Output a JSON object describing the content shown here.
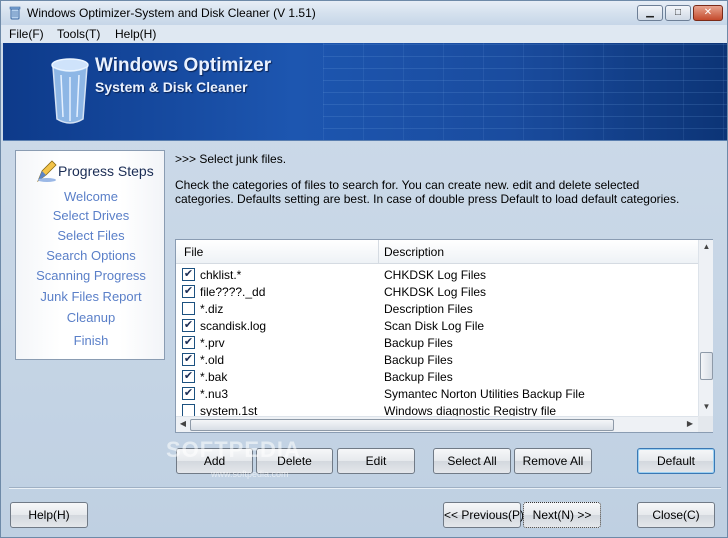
{
  "window": {
    "title": "Windows Optimizer-System and Disk Cleaner (V 1.51)",
    "minimize_glyph": "▁",
    "maximize_glyph": "□",
    "close_glyph": "✕"
  },
  "menu": {
    "items": [
      {
        "label": "File(F)"
      },
      {
        "label": "Tools(T)"
      },
      {
        "label": "Help(H)"
      }
    ]
  },
  "banner": {
    "title": "Windows Optimizer",
    "subtitle": "System & Disk Cleaner",
    "icon": "recycle-bin-icon"
  },
  "steps": {
    "title": "Progress Steps",
    "icon": "pen-icon",
    "items": [
      {
        "label": "Welcome"
      },
      {
        "label": "Select Drives"
      },
      {
        "label": "Select Files"
      },
      {
        "label": "Search Options"
      },
      {
        "label": "Scanning Progress"
      },
      {
        "label": "Junk Files Report"
      },
      {
        "label": "Cleanup"
      },
      {
        "label": "Finish"
      }
    ]
  },
  "main": {
    "instruction": ">>> Select junk files.",
    "description": "Check the categories of files to search for. You can create new. edit and delete selected categories. Defaults setting are best. In case of double press Default to load default categories."
  },
  "file_list": {
    "columns": [
      "File",
      "Description"
    ],
    "check_glyph": "✔",
    "rows": [
      {
        "file": "chklist.*",
        "description": "CHKDSK Log Files",
        "checked": true
      },
      {
        "file": "file????._dd",
        "description": "CHKDSK Log Files",
        "checked": true
      },
      {
        "file": "*.diz",
        "description": "Description Files",
        "checked": false
      },
      {
        "file": "scandisk.log",
        "description": "Scan Disk Log File",
        "checked": true
      },
      {
        "file": "*.prv",
        "description": "Backup Files",
        "checked": true
      },
      {
        "file": "*.old",
        "description": "Backup Files",
        "checked": true
      },
      {
        "file": "*.bak",
        "description": "Backup Files",
        "checked": true
      },
      {
        "file": "*.nu3",
        "description": "Symantec Norton Utilities Backup File",
        "checked": true
      },
      {
        "file": "system.1st",
        "description": "Windows diagnostic Registry file",
        "checked": false
      }
    ]
  },
  "list_buttons": {
    "add": "Add",
    "delete": "Delete",
    "edit": "Edit",
    "select_all": "Select All",
    "remove_all": "Remove All",
    "default": "Default"
  },
  "footer_buttons": {
    "help": "Help(H)",
    "previous": "<< Previous(P)",
    "next": "Next(N) >>",
    "close": "Close(C)"
  },
  "watermark": {
    "text": "SOFTPEDIA",
    "url": "www.softpedia.com"
  }
}
